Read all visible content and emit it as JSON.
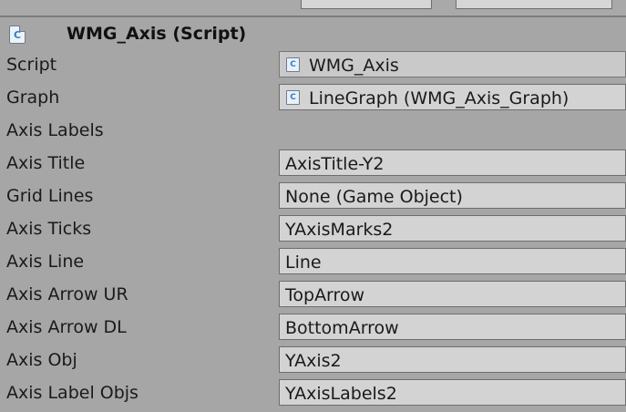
{
  "component": {
    "title": "WMG_Axis (Script)",
    "icon": "csharp-script-icon"
  },
  "fields": {
    "script": {
      "label": "Script",
      "value": "WMG_Axis",
      "icon": "csharp-script-icon"
    },
    "graph": {
      "label": "Graph",
      "value": "LineGraph (WMG_Axis_Graph)",
      "icon": "csharp-script-icon"
    },
    "axis_labels": {
      "label": "Axis Labels"
    },
    "axis_title": {
      "label": "Axis Title",
      "value": "AxisTitle-Y2"
    },
    "grid_lines": {
      "label": "Grid Lines",
      "value": "None (Game Object)"
    },
    "axis_ticks": {
      "label": "Axis Ticks",
      "value": "YAxisMarks2"
    },
    "axis_line": {
      "label": "Axis Line",
      "value": "Line"
    },
    "axis_arrow_ur": {
      "label": "Axis Arrow UR",
      "value": "TopArrow"
    },
    "axis_arrow_dl": {
      "label": "Axis Arrow DL",
      "value": "BottomArrow"
    },
    "axis_obj": {
      "label": "Axis Obj",
      "value": "YAxis2"
    },
    "axis_label_objs": {
      "label": "Axis Label Objs",
      "value": "YAxisLabels2"
    }
  }
}
